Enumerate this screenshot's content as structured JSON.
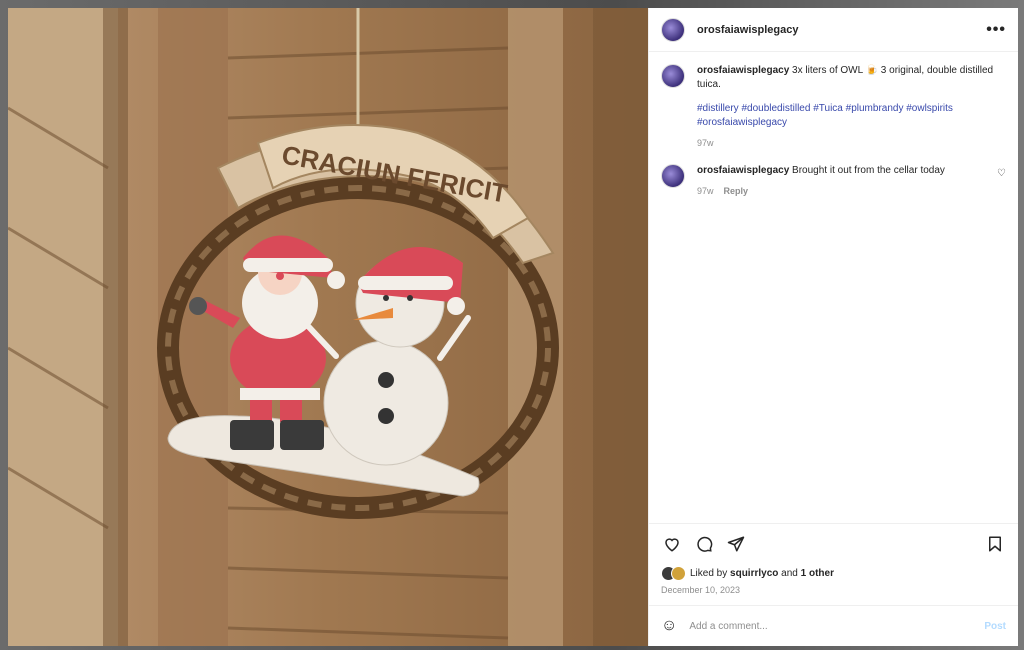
{
  "post": {
    "username": "orosfaiawisplegacy",
    "more_icon": "more-horizontal-icon",
    "photo_sign_text": "CRACIUN FERICIT"
  },
  "comments": [
    {
      "username": "orosfaiawisplegacy",
      "text": "3x liters of OWL 🍺 3 original, double distilled tuica.",
      "hashtags": [
        "#distillery",
        "#doubledistilled",
        "#Tuica",
        "#plumbrandy",
        "#owlspirits",
        "#orosfaiawisplegacy"
      ],
      "time": "97w"
    },
    {
      "username": "orosfaiawisplegacy",
      "text": "Brought it out from the cellar today",
      "time": "97w",
      "reply_label": "Reply"
    }
  ],
  "actions": {
    "like_icon": "heart-icon",
    "comment_icon": "comment-icon",
    "share_icon": "share-icon",
    "save_icon": "bookmark-icon"
  },
  "likes": {
    "prefix": "Liked by",
    "user": "squirrlyco",
    "and": "and",
    "others": "1 other"
  },
  "date": "December 10, 2023",
  "composer": {
    "emoji_icon": "smiley-icon",
    "placeholder": "Add a comment...",
    "post_label": "Post"
  }
}
